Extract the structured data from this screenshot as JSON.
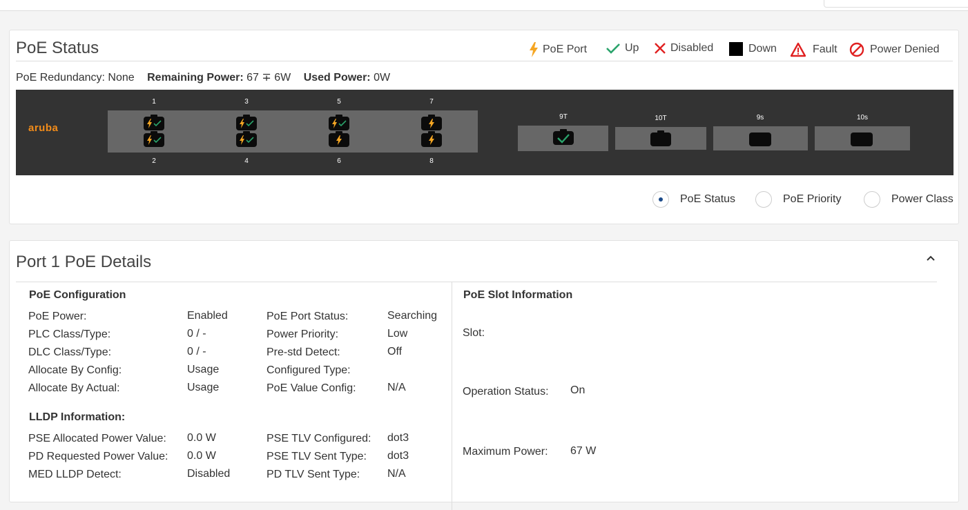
{
  "poe_status": {
    "title": "PoE Status",
    "legend": [
      {
        "icon": "bolt-icon",
        "label": "PoE Port",
        "color": "#f5a623"
      },
      {
        "icon": "check-icon",
        "label": "Up",
        "color": "#2aa36b"
      },
      {
        "icon": "x-icon",
        "label": "Disabled",
        "color": "#e02020"
      },
      {
        "icon": "square-icon",
        "label": "Down",
        "color": "#000000"
      },
      {
        "icon": "warning-triangle-icon",
        "label": "Fault",
        "color": "#e02020"
      },
      {
        "icon": "prohibited-icon",
        "label": "Power Denied",
        "color": "#e02020"
      }
    ],
    "redundancy": "PoE Redundancy: None",
    "remaining_power_label": "Remaining Power:",
    "remaining_power_value": "67 ∓ 6W",
    "used_power_label": "Used Power:",
    "used_power_value": "0W"
  },
  "switch": {
    "logo": "aruba",
    "top_port_numbers": [
      "1",
      "3",
      "5",
      "7"
    ],
    "bottom_port_numbers": [
      "2",
      "4",
      "6",
      "8"
    ],
    "ports": [
      {
        "number": "1",
        "state": "poe-up"
      },
      {
        "number": "2",
        "state": "poe-up"
      },
      {
        "number": "3",
        "state": "poe-up"
      },
      {
        "number": "4",
        "state": "poe-up"
      },
      {
        "number": "5",
        "state": "poe-up"
      },
      {
        "number": "6",
        "state": "poe"
      },
      {
        "number": "7",
        "state": "poe"
      },
      {
        "number": "8",
        "state": "poe"
      }
    ],
    "uplinks": [
      {
        "label": "9T",
        "state": "up"
      },
      {
        "label": "10T",
        "state": "down"
      },
      {
        "label": "9s",
        "state": "down"
      },
      {
        "label": "10s",
        "state": "down"
      }
    ]
  },
  "view_options": {
    "selected": "PoE Status",
    "options": [
      "PoE Status",
      "PoE Priority",
      "Power Class"
    ]
  },
  "details": {
    "title": "Port 1 PoE Details",
    "poe_config": {
      "heading": "PoE Configuration",
      "left": [
        {
          "label": "PoE Power:",
          "value": "Enabled"
        },
        {
          "label": "PLC Class/Type:",
          "value": "0 / -"
        },
        {
          "label": "DLC Class/Type:",
          "value": "0 / -"
        },
        {
          "label": "Allocate By Config:",
          "value": "Usage"
        },
        {
          "label": "Allocate By Actual:",
          "value": "Usage"
        }
      ],
      "right": [
        {
          "label": "PoE Port Status:",
          "value": "Searching"
        },
        {
          "label": "Power Priority:",
          "value": "Low"
        },
        {
          "label": "Pre-std Detect:",
          "value": "Off"
        },
        {
          "label": "Configured Type:",
          "value": ""
        },
        {
          "label": "PoE Value Config:",
          "value": "N/A"
        }
      ]
    },
    "lldp": {
      "heading": "LLDP Information:",
      "left": [
        {
          "label": "PSE Allocated Power Value:",
          "value": "0.0 W"
        },
        {
          "label": "PD Requested Power Value:",
          "value": "0.0 W"
        },
        {
          "label": "MED LLDP Detect:",
          "value": "Disabled"
        }
      ],
      "right": [
        {
          "label": "PSE TLV Configured:",
          "value": "dot3"
        },
        {
          "label": "PSE TLV Sent Type:",
          "value": "dot3"
        },
        {
          "label": "PD TLV Sent Type:",
          "value": "N/A"
        }
      ]
    },
    "slot": {
      "heading": "PoE Slot Information",
      "items": [
        {
          "label": "Slot:",
          "value": ""
        },
        {
          "label": "Operation Status:",
          "value": "On"
        },
        {
          "label": "Maximum Power:",
          "value": "67 W"
        }
      ]
    }
  }
}
